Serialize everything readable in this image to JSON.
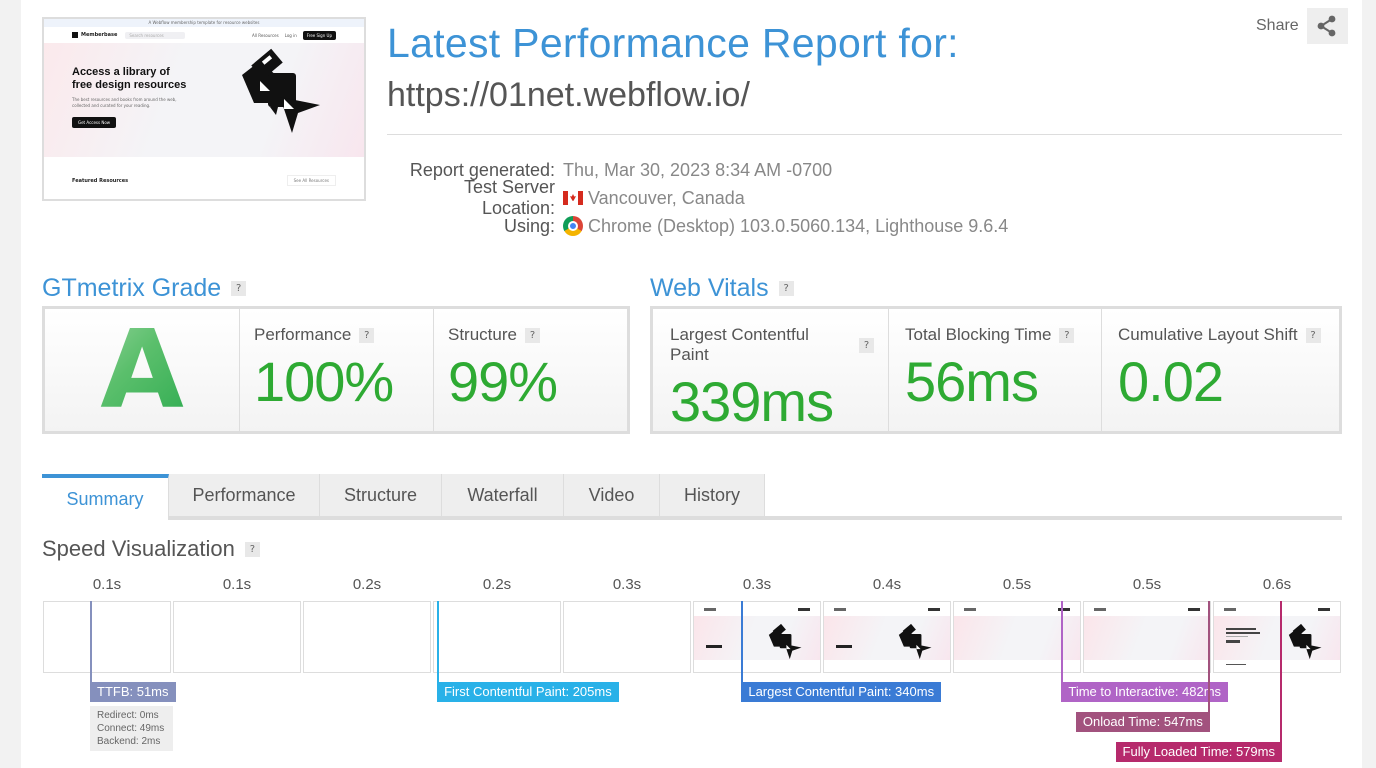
{
  "header": {
    "title": "Latest Performance Report for:",
    "url": "https://01net.webflow.io/",
    "share_label": "Share"
  },
  "thumbnail": {
    "banner": "A Webflow membership template for resource websites",
    "brand": "Memberbase",
    "search_placeholder": "Search resources",
    "nav_links": [
      "All Resources",
      "Log in"
    ],
    "signup": "Free Sign Up",
    "hero_title_1": "Access a library of",
    "hero_title_2": "free design resources",
    "hero_text": "The best resources and books from around the web, collected and curated for your reading.",
    "cta": "Get Access Now",
    "featured": "Featured Resources",
    "see_all": "See All Resources"
  },
  "meta": {
    "rows": [
      {
        "key": "Report generated:",
        "value": "Thu, Mar 30, 2023 8:34 AM -0700",
        "icon": ""
      },
      {
        "key": "Test Server Location:",
        "value": "Vancouver, Canada",
        "icon": "canada-flag"
      },
      {
        "key": "Using:",
        "value": "Chrome (Desktop) 103.0.5060.134, Lighthouse 9.6.4",
        "icon": "chrome-icon"
      }
    ]
  },
  "grade": {
    "heading": "GTmetrix Grade",
    "letter": "A",
    "help": "?",
    "items": [
      {
        "label": "Performance",
        "value": "100%"
      },
      {
        "label": "Structure",
        "value": "99%"
      }
    ]
  },
  "vitals": {
    "heading": "Web Vitals",
    "help": "?",
    "items": [
      {
        "label": "Largest Contentful Paint",
        "value": "339ms"
      },
      {
        "label": "Total Blocking Time",
        "value": "56ms"
      },
      {
        "label": "Cumulative Layout Shift",
        "value": "0.02"
      }
    ]
  },
  "tabs": [
    {
      "label": "Summary",
      "active": true
    },
    {
      "label": "Performance",
      "active": false
    },
    {
      "label": "Structure",
      "active": false
    },
    {
      "label": "Waterfall",
      "active": false
    },
    {
      "label": "Video",
      "active": false
    },
    {
      "label": "History",
      "active": false
    }
  ],
  "speed_visualization": {
    "heading": "Speed Visualization",
    "help": "?",
    "frame_times": [
      "0.1s",
      "0.1s",
      "0.2s",
      "0.2s",
      "0.3s",
      "0.3s",
      "0.4s",
      "0.5s",
      "0.5s",
      "0.6s"
    ],
    "frame_states": [
      "blank",
      "blank",
      "blank",
      "blank",
      "blank",
      "partial",
      "partial",
      "bg",
      "bg-nav",
      "full"
    ],
    "markers": [
      {
        "label": "TTFB: 51ms",
        "ms": 51,
        "color": "#8590bd"
      },
      {
        "label": "First Contentful Paint: 205ms",
        "ms": 205,
        "color": "#29b1e8"
      },
      {
        "label": "Largest Contentful Paint: 340ms",
        "ms": 340,
        "color": "#3a7bd5"
      },
      {
        "label": "Time to Interactive: 482ms",
        "ms": 482,
        "color": "#b064c6"
      },
      {
        "label": "Onload Time: 547ms",
        "ms": 547,
        "color": "#a2527e"
      },
      {
        "label": "Fully Loaded Time: 579ms",
        "ms": 579,
        "color": "#b62a6c"
      }
    ],
    "ttfb_details": [
      "Redirect: 0ms",
      "Connect: 49ms",
      "Backend: 2ms"
    ]
  }
}
